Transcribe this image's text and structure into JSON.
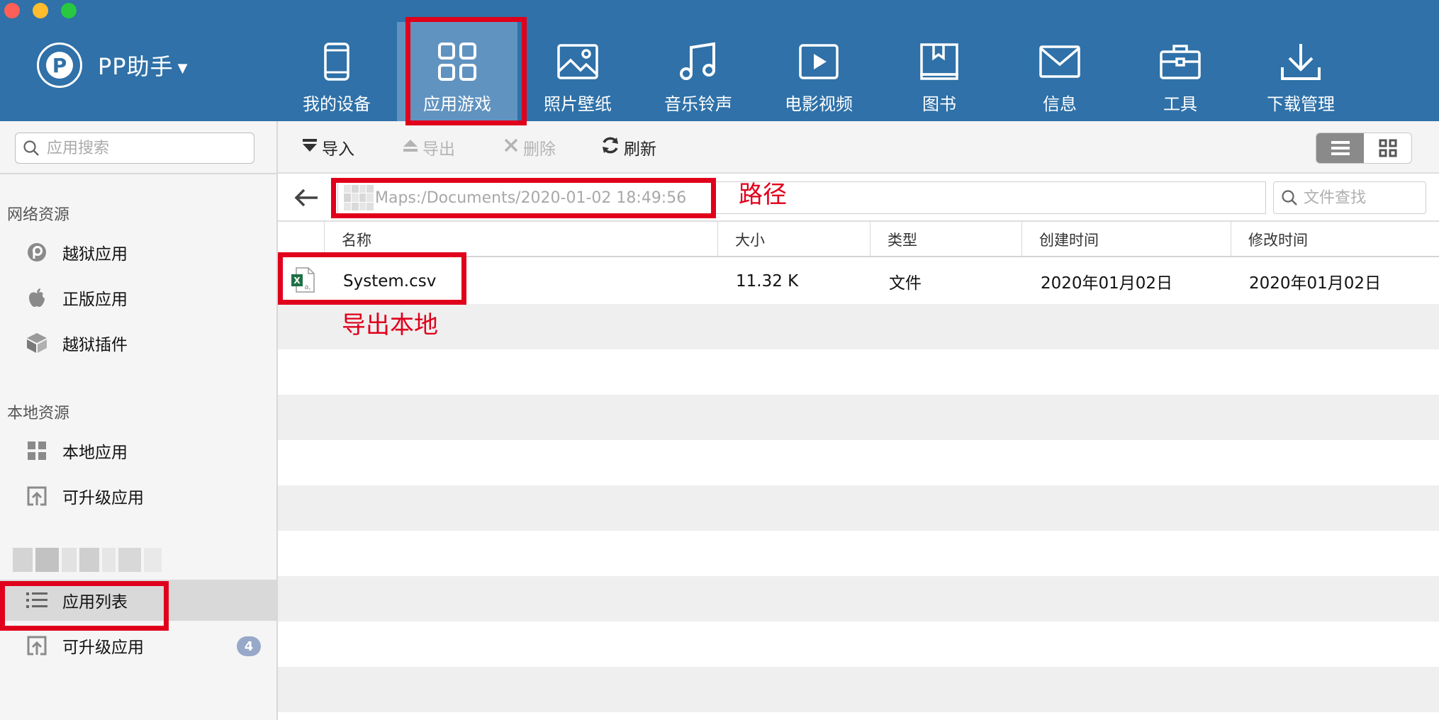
{
  "app": {
    "name": "PP助手",
    "brand_color": "#2f71a8",
    "accent_red": "#e0001b"
  },
  "nav": {
    "items": [
      {
        "label": "我的设备",
        "icon": "tablet-icon"
      },
      {
        "label": "应用游戏",
        "icon": "app-grid-icon",
        "active": true
      },
      {
        "label": "照片壁纸",
        "icon": "photo-icon"
      },
      {
        "label": "音乐铃声",
        "icon": "music-note-icon"
      },
      {
        "label": "电影视频",
        "icon": "play-video-icon"
      },
      {
        "label": "图书",
        "icon": "book-icon"
      },
      {
        "label": "信息",
        "icon": "envelope-icon"
      },
      {
        "label": "工具",
        "icon": "toolbox-icon"
      },
      {
        "label": "下载管理",
        "icon": "download-icon"
      }
    ]
  },
  "sidebar": {
    "search_placeholder": "应用搜索",
    "section_network": "网络资源",
    "section_local": "本地资源",
    "items": [
      {
        "label": "越狱应用",
        "icon": "pp-logo-icon"
      },
      {
        "label": "正版应用",
        "icon": "apple-icon"
      },
      {
        "label": "越狱插件",
        "icon": "plugin-cube-icon"
      },
      {
        "label": "本地应用",
        "icon": "app-grid-icon"
      },
      {
        "label": "可升级应用",
        "icon": "upgrade-icon"
      },
      {
        "label": "应用列表",
        "icon": "list-icon",
        "active": true
      },
      {
        "label": "可升级应用",
        "icon": "upgrade-icon",
        "badge": "4"
      }
    ]
  },
  "toolbar": {
    "import_label": "导入",
    "export_label": "导出",
    "delete_label": "删除",
    "refresh_label": "刷新",
    "view_mode": "list"
  },
  "pathbar": {
    "path": "Maps:/Documents/2020-01-02 18:49:56",
    "file_search_placeholder": "文件查找"
  },
  "table": {
    "columns": [
      "名称",
      "大小",
      "类型",
      "创建时间",
      "修改时间"
    ],
    "rows": [
      {
        "name": "System.csv",
        "size": "11.32 K",
        "type": "文件",
        "created": "2020年01月02日",
        "modified": "2020年01月02日",
        "icon": "excel-file-icon"
      }
    ]
  },
  "annotations": {
    "path_note": "路径",
    "export_note": "导出本地"
  }
}
